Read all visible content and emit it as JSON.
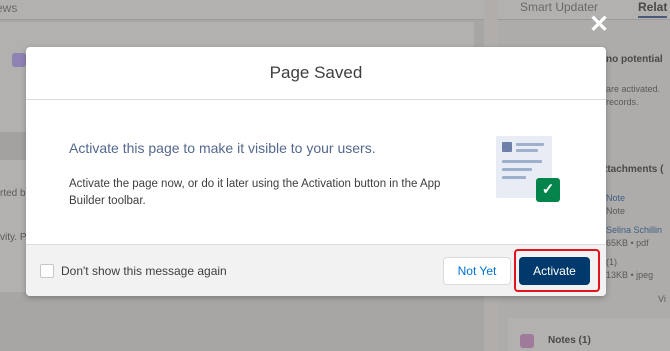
{
  "background": {
    "left_tab_fragment": "ews",
    "left_snippets": [
      "rted b",
      "vity. P"
    ],
    "right_tabs": [
      "Smart Updater",
      "Relat"
    ],
    "right_snippets": {
      "potential": "no potential",
      "activated": "are activated.",
      "records": "records.",
      "attachments": "ttachments (",
      "note": "Note",
      "note2": "Note",
      "selina": "Selina Schillin",
      "size1": "65KB • pdf",
      "one": "(1)",
      "size2": "13KB • jpeg",
      "view": "Vi",
      "notes": "Notes (1)"
    }
  },
  "close_icon_glyph": "✕",
  "modal": {
    "title": "Page Saved",
    "headline": "Activate this page to make it visible to your users.",
    "description": "Activate the page now, or do it later using the Activation button in the App Builder toolbar.",
    "checkbox_label": "Don't show this message again",
    "checkbox_checked": false,
    "not_yet_label": "Not Yet",
    "activate_label": "Activate",
    "check_glyph": "✓"
  },
  "colors": {
    "activate_button": "#00396b",
    "highlight": "#e3131b",
    "check_badge": "#04844b",
    "link_text": "#0070d2"
  }
}
